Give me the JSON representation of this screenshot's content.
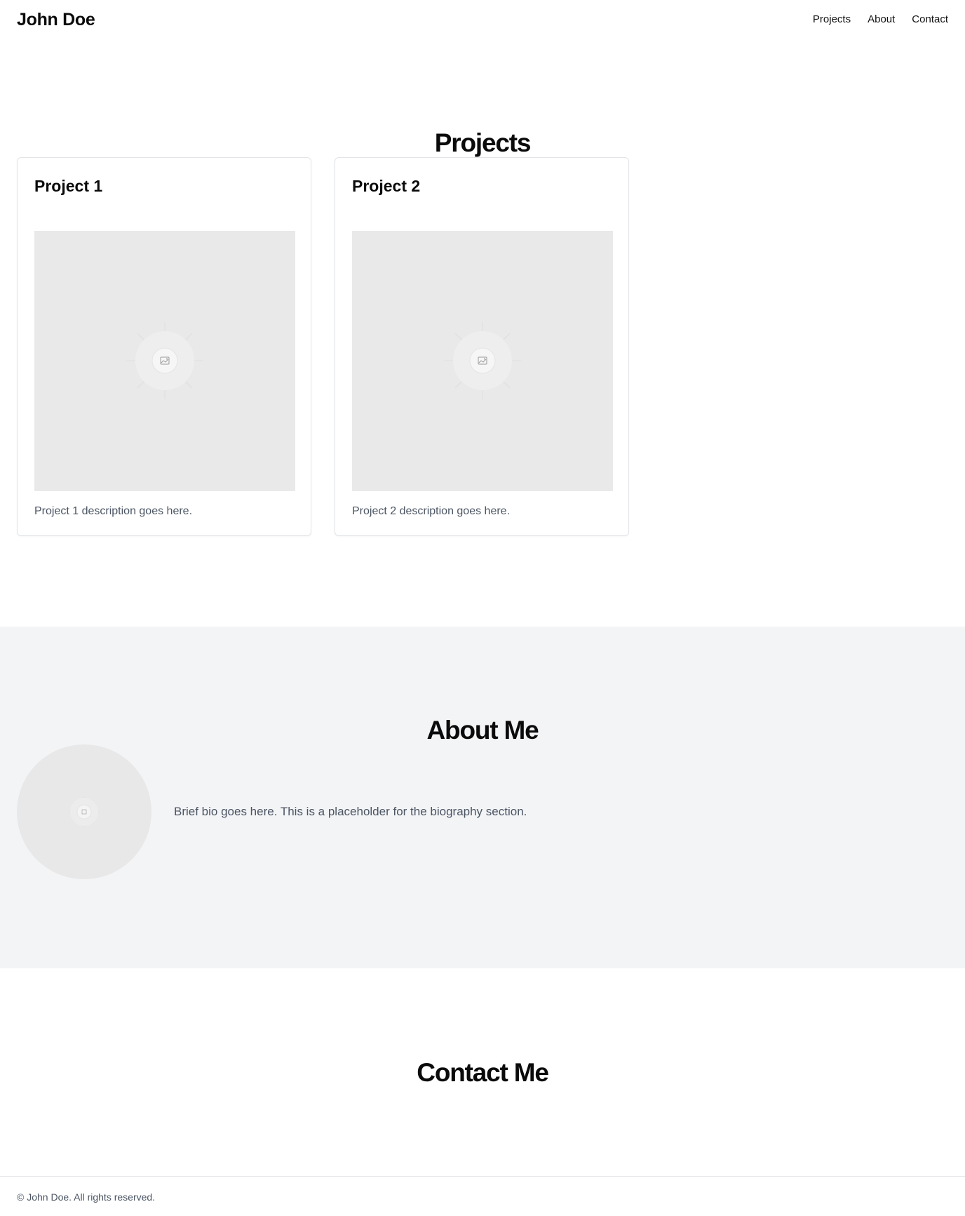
{
  "header": {
    "brand": "John Doe",
    "nav": [
      "Projects",
      "About",
      "Contact"
    ]
  },
  "projects": {
    "title": "Projects",
    "items": [
      {
        "title": "Project 1",
        "image_icon": "image-placeholder-icon",
        "description": "Project 1 description goes here."
      },
      {
        "title": "Project 2",
        "image_icon": "image-placeholder-icon",
        "description": "Project 2 description goes here."
      }
    ]
  },
  "about": {
    "title": "About Me",
    "avatar_icon": "image-placeholder-icon",
    "bio": "Brief bio goes here. This is a placeholder for the biography section."
  },
  "contact": {
    "title": "Contact Me"
  },
  "footer": {
    "text": "© John Doe. All rights reserved."
  },
  "colors": {
    "background": "#ffffff",
    "text": "#0b0b0c",
    "muted_text": "#4b5563",
    "about_background": "#f3f4f6",
    "placeholder": "#e9e9e9",
    "border": "#e2e4e8"
  }
}
